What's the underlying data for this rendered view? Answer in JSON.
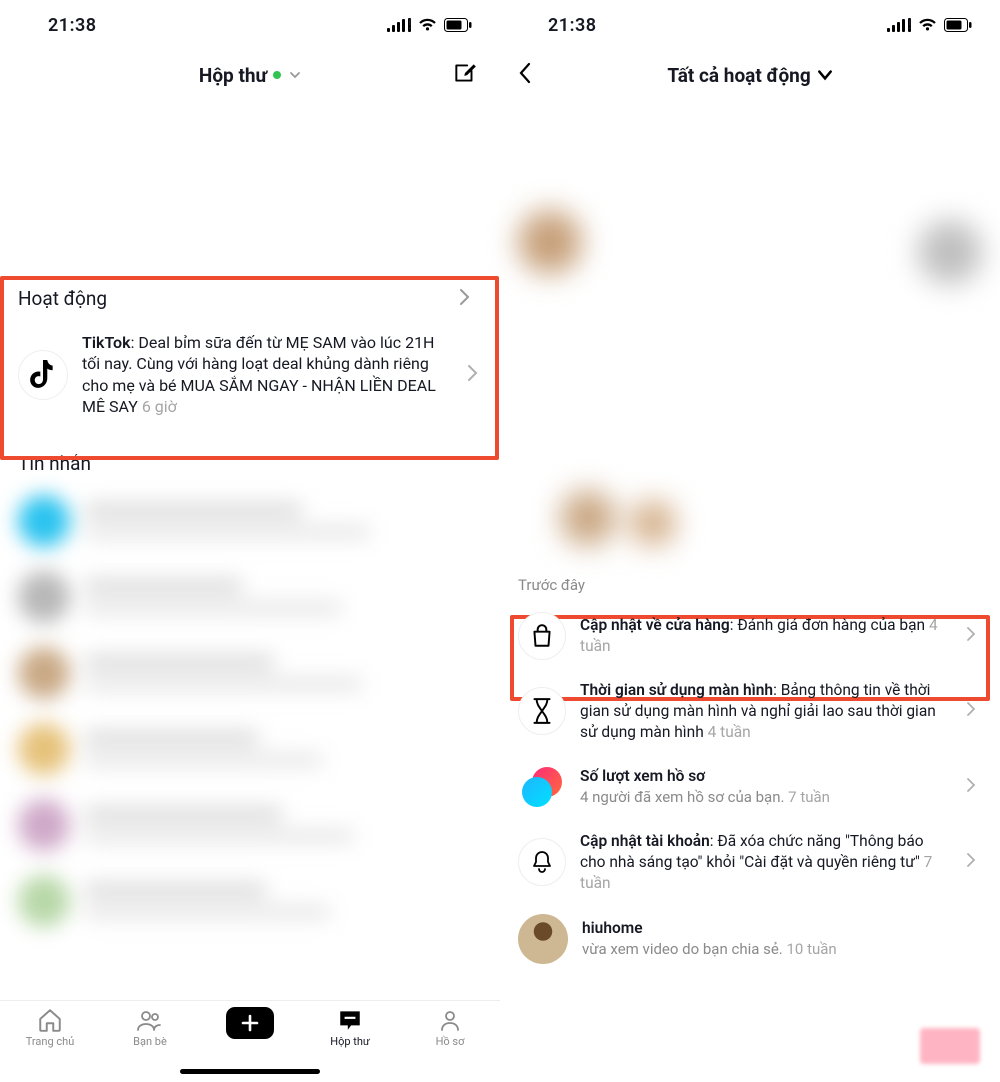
{
  "statusbar": {
    "time": "21:38"
  },
  "left": {
    "header_title": "Hộp thư",
    "activity_label": "Hoạt động",
    "messages_label": "Tin nhắn",
    "tiktok_row": {
      "sender": "TikTok",
      "text": ": Deal bỉm sữa đến từ MẸ SAM vào lúc 21H tối nay. Cùng với hàng loạt deal khủng dành riêng cho mẹ và bé MUA SẮM NGAY - NHẬN LIỀN DEAL MÊ SAY ",
      "time": "6 giờ"
    },
    "tabs": {
      "home": "Trang chủ",
      "friends": "Bạn bè",
      "inbox": "Hộp thư",
      "profile": "Hồ sơ"
    }
  },
  "right": {
    "header_title": "Tất cả hoạt động",
    "earlier_label": "Trước đây",
    "rows": {
      "shop": {
        "lead": "Cập nhật về cửa hàng",
        "text": ": Đánh giá đơn hàng của bạn ",
        "time": "4 tuần"
      },
      "screen": {
        "lead": "Thời gian sử dụng màn hình",
        "text": ": Bảng thông tin về thời gian sử dụng màn hình và nghỉ giải lao sau thời gian sử dụng màn hình ",
        "time": "4 tuần"
      },
      "views": {
        "lead": "Số lượt xem hồ sơ",
        "sub_pre": "4 người đã xem hồ sơ của bạn. ",
        "time": "7 tuần"
      },
      "account": {
        "lead": "Cập nhật tài khoản",
        "text": ": Đã xóa chức năng \"Thông báo cho nhà sáng tạo\" khỏi \"Cài đặt và quyền riêng tư\" ",
        "time": "7 tuần"
      },
      "user": {
        "lead": "hiuhome",
        "sub_pre": "vừa xem video do bạn chia sẻ. ",
        "time": "10 tuần"
      }
    }
  }
}
